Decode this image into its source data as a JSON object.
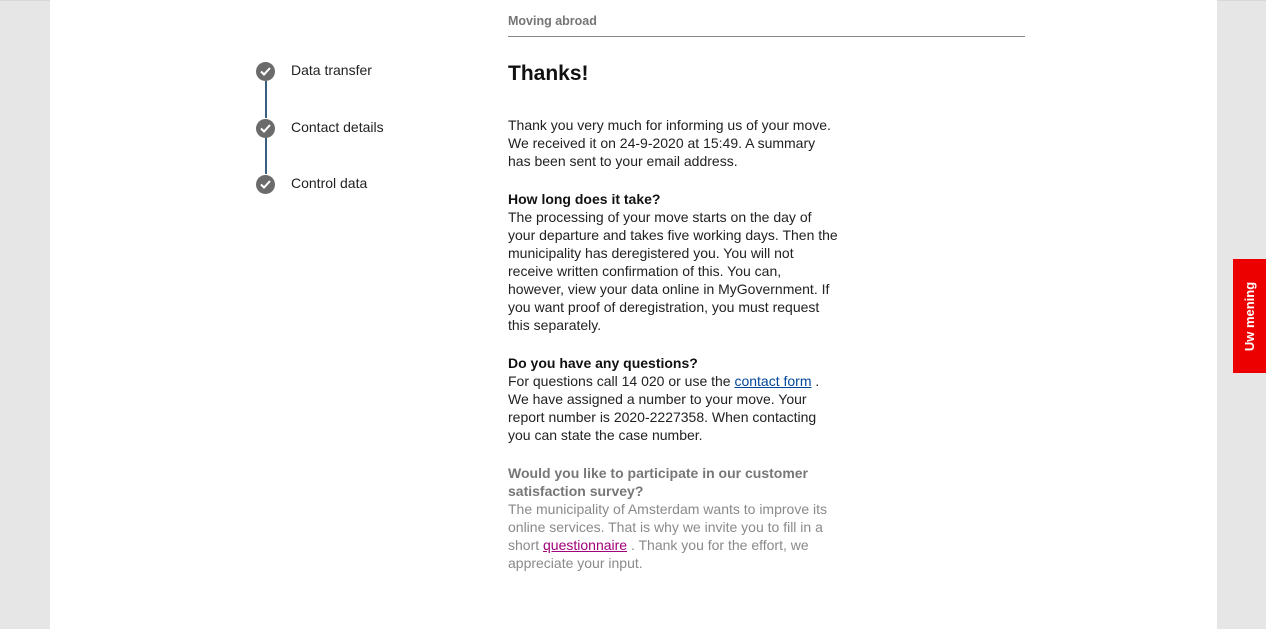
{
  "breadcrumb": {
    "label": "Moving abroad"
  },
  "steps": [
    {
      "label": "Data transfer",
      "icon": "check-icon"
    },
    {
      "label": "Contact details",
      "icon": "check-icon"
    },
    {
      "label": "Control data",
      "icon": "check-icon"
    }
  ],
  "main": {
    "title": "Thanks!",
    "intro": "Thank you very much for informing us of your move. We received it on 24-9-2020 at 15:49. A summary has been sent to your email address.",
    "how_long": {
      "heading": "How long does it take?",
      "body": "The processing of your move starts on the day of your departure and takes five working days. Then the municipality has deregistered you. You will not receive written confirmation of this. You can, however, view your data online in MyGovernment. If you want proof of deregistration, you must request this separately."
    },
    "questions": {
      "heading": "Do you have any questions?",
      "body_before": "For questions call 14 020 or use the",
      "link": "contact form",
      "body_after": ". We have assigned a number to your move. Your report number is 2020-2227358. When contacting you can state the case number."
    },
    "survey": {
      "heading": "Would you like to participate in our customer satisfaction survey?",
      "body_before": "The municipality of Amsterdam wants to improve its online services. That is why we invite you to fill in a short",
      "link": "questionnaire",
      "body_after": ". Thank you for the effort, we appreciate your input."
    }
  },
  "feedback_tab": {
    "label": "Uw mening"
  },
  "colors": {
    "accent_red": "#ec0000",
    "link_blue": "#004699",
    "link_magenta": "#a00078",
    "step_dot": "#6b6b6b",
    "connector": "#3b5f7f"
  }
}
